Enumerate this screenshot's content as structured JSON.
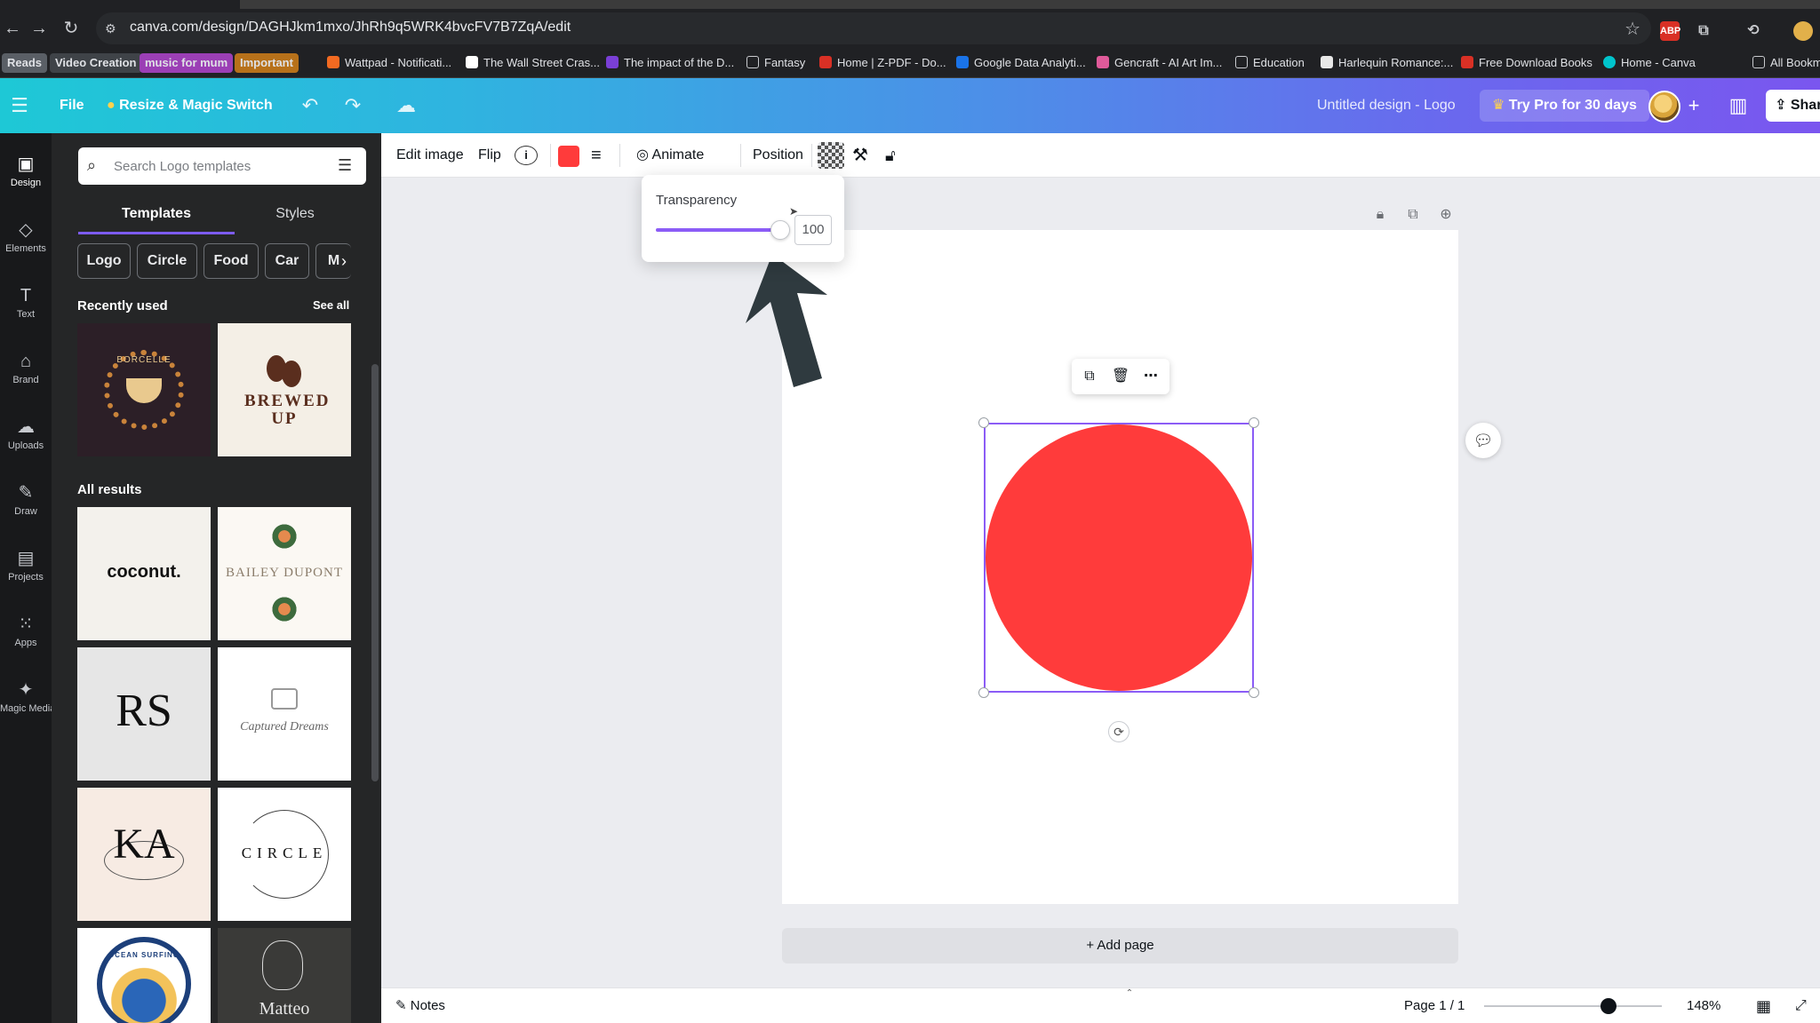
{
  "browser": {
    "url": "canva.com/design/DAGHJkm1mxo/JhRh9q5WRK4bvcFV7B7ZqA/edit",
    "extensions": [
      "ABP"
    ],
    "bookmarks": [
      {
        "label": "Reads",
        "kind": "tag",
        "color": "#5a5f66"
      },
      {
        "label": "Video Creation",
        "kind": "tag",
        "color": "#4a4e55"
      },
      {
        "label": "music for mum",
        "kind": "tag",
        "color": "#9b3fb5"
      },
      {
        "label": "Important",
        "kind": "tag",
        "color": "#d98c1a"
      },
      {
        "label": "Wattpad - Notificati...",
        "kind": "link"
      },
      {
        "label": "The Wall Street Cras...",
        "kind": "link"
      },
      {
        "label": "The impact of the D...",
        "kind": "link"
      },
      {
        "label": "Fantasy",
        "kind": "folder"
      },
      {
        "label": "Home | Z-PDF - Do...",
        "kind": "link"
      },
      {
        "label": "Google Data Analyti...",
        "kind": "link"
      },
      {
        "label": "Gencraft - AI Art Im...",
        "kind": "link"
      },
      {
        "label": "Education",
        "kind": "folder"
      },
      {
        "label": "Harlequin Romance:...",
        "kind": "link"
      },
      {
        "label": "Free Download Books",
        "kind": "link"
      },
      {
        "label": "Home - Canva",
        "kind": "link"
      },
      {
        "label": "All Bookmarks",
        "kind": "folder"
      }
    ]
  },
  "header": {
    "file_label": "File",
    "resize_label": "Resize & Magic Switch",
    "doc_title": "Untitled design - Logo",
    "try_pro_label": "Try Pro for 30 days",
    "share_label": "Share"
  },
  "rail": [
    {
      "label": "Design",
      "icon": "design-icon"
    },
    {
      "label": "Elements",
      "icon": "elements-icon"
    },
    {
      "label": "Text",
      "icon": "text-icon"
    },
    {
      "label": "Brand",
      "icon": "brand-icon"
    },
    {
      "label": "Uploads",
      "icon": "uploads-icon"
    },
    {
      "label": "Draw",
      "icon": "draw-icon"
    },
    {
      "label": "Projects",
      "icon": "projects-icon"
    },
    {
      "label": "Apps",
      "icon": "apps-icon"
    },
    {
      "label": "Magic Media",
      "icon": "magic-media-icon"
    }
  ],
  "panel": {
    "search_placeholder": "Search Logo templates",
    "tabs": [
      "Templates",
      "Styles"
    ],
    "chips": [
      "Logo",
      "Circle",
      "Food",
      "Car",
      "M"
    ],
    "recently_used_title": "Recently used",
    "see_all_label": "See all",
    "all_results_title": "All results",
    "recent_templates": [
      "BORCELLE",
      "BREWED UP"
    ],
    "result_templates": [
      "coconut.",
      "BAILEY DUPONT",
      "RS",
      "Captured Dreams",
      "KA",
      "CIRCLE",
      "OCEAN SURFING",
      "Matteo"
    ]
  },
  "toolbar": {
    "edit_image": "Edit image",
    "flip": "Flip",
    "fill_color": "#ff3b3b",
    "animate": "Animate",
    "position": "Position"
  },
  "transparency": {
    "label": "Transparency",
    "value": "100",
    "fraction": 1.0
  },
  "canvas": {
    "shape_color": "#ff3b3b",
    "add_page_label": "+ Add page"
  },
  "footer": {
    "notes_label": "Notes",
    "page_label": "Page 1 / 1",
    "zoom_label": "148%"
  }
}
